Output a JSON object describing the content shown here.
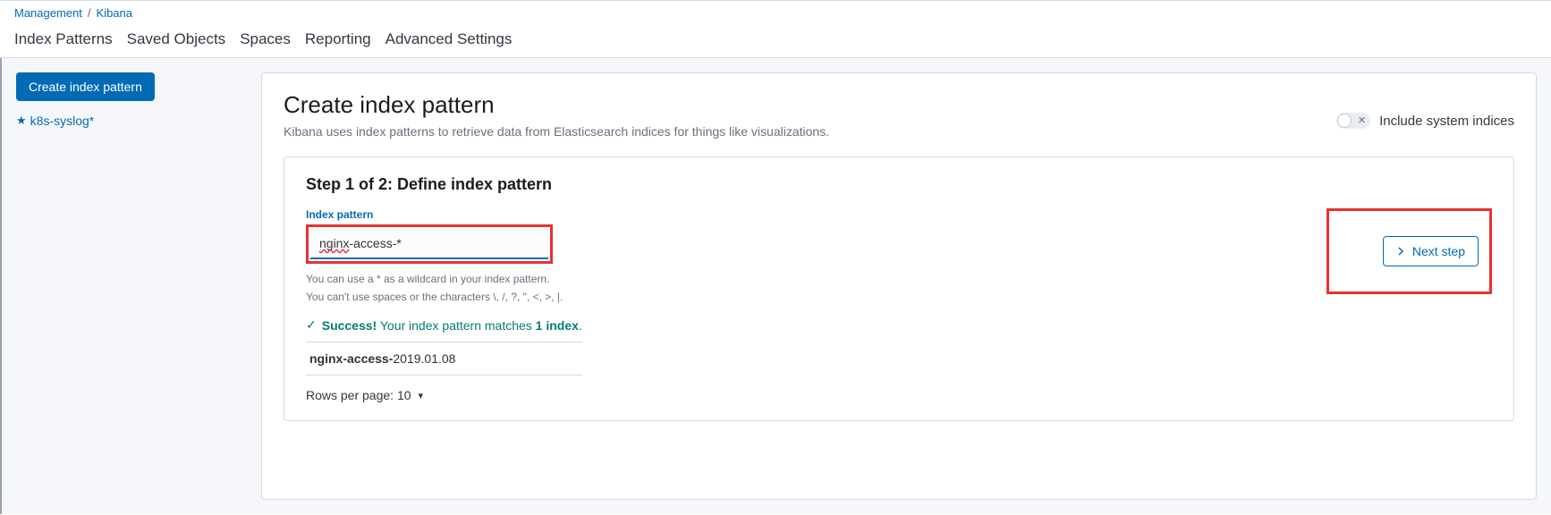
{
  "breadcrumb": {
    "parent": "Management",
    "current": "Kibana"
  },
  "tabs": {
    "index_patterns": "Index Patterns",
    "saved_objects": "Saved Objects",
    "spaces": "Spaces",
    "reporting": "Reporting",
    "advanced_settings": "Advanced Settings"
  },
  "sidebar": {
    "create_button": "Create index pattern",
    "items": [
      {
        "label": "k8s-syslog*"
      }
    ]
  },
  "header": {
    "title": "Create index pattern",
    "description": "Kibana uses index patterns to retrieve data from Elasticsearch indices for things like visualizations.",
    "toggle_label": "Include system indices"
  },
  "step": {
    "title": "Step 1 of 2: Define index pattern",
    "field_label": "Index pattern",
    "input_value_prefix": "nginx",
    "input_value_suffix": "-access-*",
    "help1": "You can use a * as a wildcard in your index pattern.",
    "help2": "You can't use spaces or the characters \\, /, ?, \", <, >, |.",
    "next_button": "Next step",
    "success_prefix": "Success!",
    "success_mid": " Your index pattern matches ",
    "success_bold": "1 index",
    "success_suffix": ".",
    "matches": [
      {
        "prefix": "nginx-access-",
        "suffix": "2019.01.08"
      }
    ],
    "pager": "Rows per page: 10"
  }
}
